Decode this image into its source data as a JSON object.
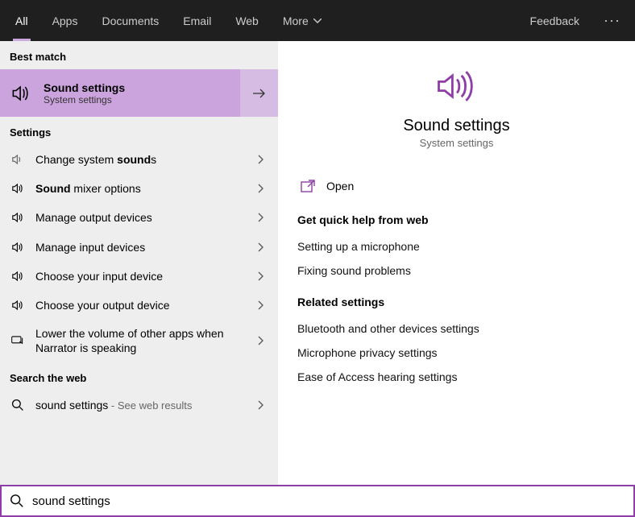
{
  "topbar": {
    "tabs": [
      "All",
      "Apps",
      "Documents",
      "Email",
      "Web",
      "More"
    ],
    "feedback": "Feedback"
  },
  "left": {
    "best_match_header": "Best match",
    "best_match": {
      "title": "Sound settings",
      "subtitle": "System settings"
    },
    "settings_header": "Settings",
    "items": [
      {
        "pre": "Change system ",
        "bold": "sound",
        "post": "s"
      },
      {
        "pre": "",
        "bold": "Sound",
        "post": " mixer options"
      },
      {
        "pre": "Manage output devices",
        "bold": "",
        "post": ""
      },
      {
        "pre": "Manage input devices",
        "bold": "",
        "post": ""
      },
      {
        "pre": "Choose your input device",
        "bold": "",
        "post": ""
      },
      {
        "pre": "Choose your output device",
        "bold": "",
        "post": ""
      },
      {
        "pre": "Lower the volume of other apps when Narrator is speaking",
        "bold": "",
        "post": ""
      }
    ],
    "web_header": "Search the web",
    "web_item": {
      "query": "sound settings",
      "suffix": " - See web results"
    }
  },
  "detail": {
    "title": "Sound settings",
    "subtitle": "System settings",
    "open_label": "Open",
    "help_header": "Get quick help from web",
    "help_links": [
      "Setting up a microphone",
      "Fixing sound problems"
    ],
    "related_header": "Related settings",
    "related_links": [
      "Bluetooth and other devices settings",
      "Microphone privacy settings",
      "Ease of Access hearing settings"
    ]
  },
  "search": {
    "value": "sound settings"
  },
  "colors": {
    "accent": "#8e3ea6"
  }
}
